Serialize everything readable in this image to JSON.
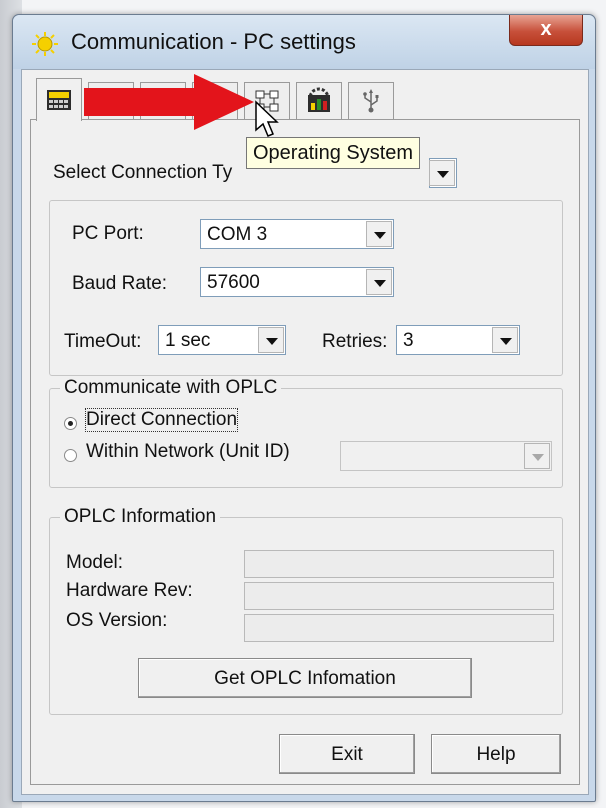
{
  "window": {
    "title": "Communication - PC settings",
    "close_glyph": "x"
  },
  "tabs": [
    {
      "icon": "controller-icon",
      "active": true
    },
    {
      "icon": "text-tab-icon"
    },
    {
      "icon": "text-tab-icon-2"
    },
    {
      "icon": "operating-system-icon",
      "hovered": true
    },
    {
      "icon": "network-nodes-icon"
    },
    {
      "icon": "chart-screen-icon"
    },
    {
      "icon": "usb-icon"
    }
  ],
  "tooltip": {
    "text": "Operating System"
  },
  "connection": {
    "label": "Select Connection Ty"
  },
  "pc_port": {
    "label": "PC Port:",
    "value": "COM 3"
  },
  "baud_rate": {
    "label": "Baud Rate:",
    "value": "57600"
  },
  "timeout": {
    "label": "TimeOut:",
    "value": "1 sec"
  },
  "retries": {
    "label": "Retries:",
    "value": "3"
  },
  "communicate": {
    "title": "Communicate with OPLC",
    "direct": "Direct Connection",
    "network": "Within Network (Unit ID)",
    "selected": "direct"
  },
  "info": {
    "title": "OPLC Information",
    "model_label": "Model:",
    "hardware_label": "Hardware Rev:",
    "os_label": "OS Version:",
    "get_button": "Get OPLC Infomation"
  },
  "footer": {
    "exit": "Exit",
    "help": "Help"
  },
  "colors": {
    "annotation_arrow": "#e3141b",
    "tooltip_bg": "#ffffe1",
    "close_button": "#c7503a"
  }
}
